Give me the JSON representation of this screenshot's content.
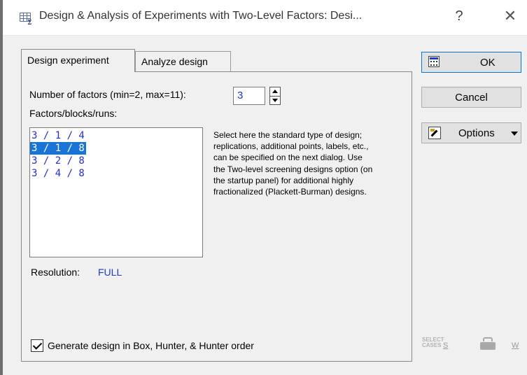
{
  "window": {
    "title": "Design & Analysis of Experiments with Two-Level Factors: Desi...",
    "help_label": "?",
    "close_label": "✕"
  },
  "tabs": [
    {
      "label": "Design experiment",
      "active": true
    },
    {
      "label": "Analyze design",
      "active": false
    }
  ],
  "design": {
    "num_factors_label": "Number of factors (min=2, max=11):",
    "num_factors_value": "3",
    "factors_list_label": "Factors/blocks/runs:",
    "designs": [
      {
        "label": "3 / 1 / 4",
        "selected": false
      },
      {
        "label": "3 / 1 / 8",
        "selected": true
      },
      {
        "label": "3 / 2 / 8",
        "selected": false
      },
      {
        "label": "3 / 4 / 8",
        "selected": false
      }
    ],
    "help_text": "Select here the standard type of design; replications, additional points, labels, etc., can be specified on the next dialog. Use the Two-level screening designs option (on the startup panel) for additional highly fractionalized (Plackett-Burman) designs.",
    "resolution_label": "Resolution:",
    "resolution_value": "FULL",
    "generate_checkbox_label": "Generate design in Box, Hunter, & Hunter order",
    "generate_checked": true
  },
  "buttons": {
    "ok": "OK",
    "cancel": "Cancel",
    "options": "Options"
  },
  "bottom_icons": {
    "select_cases_icon_text": "SELECT\nCASES",
    "select_cases_key": "S",
    "weight_key": "W"
  },
  "colors": {
    "value_blue": "#1a3cc8",
    "selection": "#1874d6",
    "ok_border": "#0078d7"
  }
}
